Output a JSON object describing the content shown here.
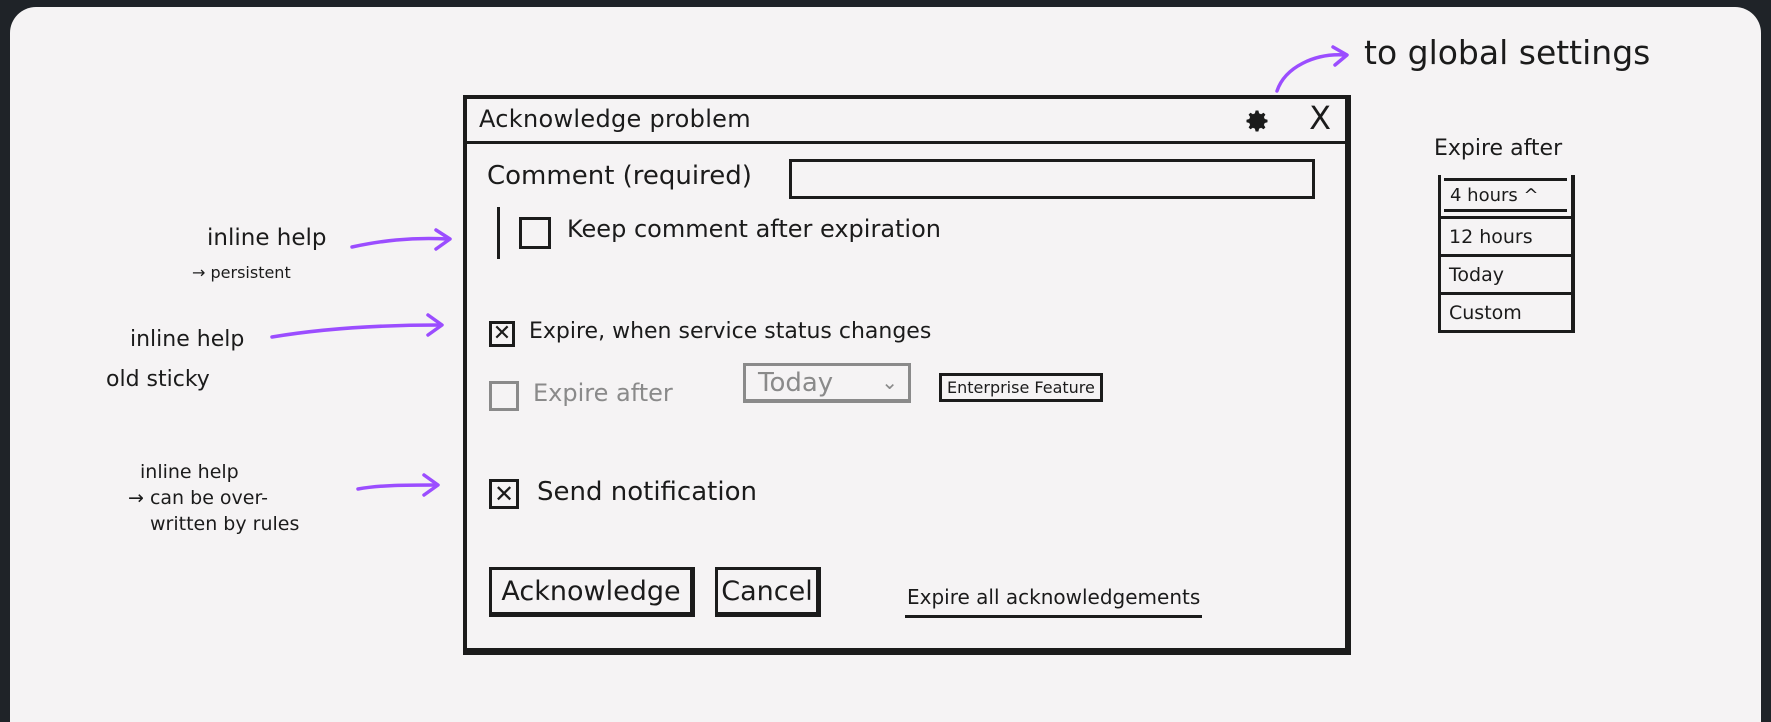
{
  "annotations": {
    "global": "to global settings",
    "help1_line1": "inline help",
    "help1_line2": "→ persistent",
    "help2_line1": "inline help",
    "help2_line2": "old sticky",
    "help3_line1": "inline help",
    "help3_line2": "→ can be over-",
    "help3_line3": "written by rules",
    "arrow_color": "#9b4dff"
  },
  "dialog": {
    "title": "Acknowledge problem",
    "gear_icon": "gear-icon",
    "close_label": "X",
    "comment_label": "Comment (required)",
    "comment_value": "",
    "keep_comment": {
      "label": "Keep comment after expiration",
      "checked": false
    },
    "expire_on_change": {
      "label": "Expire, when service status changes",
      "checked": true
    },
    "expire_after": {
      "label": "Expire after",
      "checked": false,
      "disabled": true,
      "select_value": "Today"
    },
    "enterprise_badge": "Enterprise Feature",
    "send_notification": {
      "label": "Send notification",
      "checked": true
    },
    "acknowledge_button": "Acknowledge",
    "cancel_button": "Cancel",
    "expire_all_link": "Expire all acknowledgements"
  },
  "dropdown_sketch": {
    "title": "Expire after",
    "selected": "4 hours ^",
    "options": [
      "12 hours",
      "Today",
      "Custom"
    ]
  }
}
